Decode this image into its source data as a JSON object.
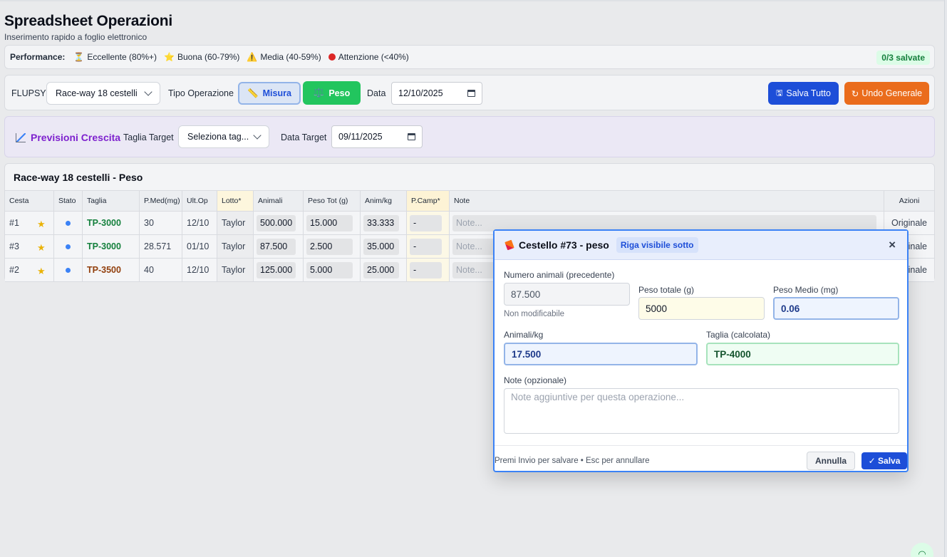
{
  "page": {
    "title": "Spreadsheet Operazioni",
    "subtitle": "Inserimento rapido a foglio elettronico"
  },
  "performance": {
    "label": "Performance:",
    "items": [
      {
        "icon": "hourglass-icon",
        "glyph": "⏳",
        "text": "Eccellente (80%+)"
      },
      {
        "icon": "star-icon",
        "glyph": "⭐",
        "text": "Buona (60-79%)"
      },
      {
        "icon": "warning-icon",
        "glyph": "⚠️",
        "text": "Media (40-59%)"
      },
      {
        "icon": "red-dot-icon",
        "glyph": "",
        "text": "Attenzione (<40%)"
      }
    ],
    "saved_badge": "0/3 salvate"
  },
  "toolbar": {
    "flupsy_label": "FLUPSY",
    "flupsy_value": "Race-way 18 cestelli",
    "tipo_label": "Tipo Operazione",
    "misura_label": "Misura",
    "peso_label": "Peso",
    "data_label": "Data",
    "data_value": "12/10/2025",
    "save_all_label": "Salva Tutto",
    "undo_label": "Undo Generale"
  },
  "forecast": {
    "title": "Previsioni Crescita",
    "target_size_label": "Taglia Target",
    "target_size_value": "Seleziona tag...",
    "target_date_label": "Data Target",
    "target_date_value": "09/11/2025"
  },
  "table": {
    "title": "Race-way 18 cestelli - Peso",
    "columns": [
      "Cesta",
      "Stato",
      "Taglia",
      "P.Med(mg)",
      "Ult.Op",
      "Lotto*",
      "Animali",
      "Peso Tot (g)",
      "Anim/kg",
      "P.Camp*",
      "Note",
      "Azioni"
    ],
    "rows": [
      {
        "cesta": "#1",
        "taglia": "TP-3000",
        "pmed": "30",
        "ultop": "12/10",
        "lotto": "Taylor",
        "animali": "500.000",
        "peso": "15.000",
        "animkg": "33.333",
        "pcamp": "-",
        "note": "Note...",
        "azioni": "Originale"
      },
      {
        "cesta": "#3",
        "taglia": "TP-3000",
        "pmed": "28.571",
        "ultop": "01/10",
        "lotto": "Taylor",
        "animali": "87.500",
        "peso": "2.500",
        "animkg": "35.000",
        "pcamp": "-",
        "note": "Note...",
        "azioni": "Originale"
      },
      {
        "cesta": "#2",
        "taglia": "TP-3500",
        "pmed": "40",
        "ultop": "12/10",
        "lotto": "Taylor",
        "animali": "125.000",
        "peso": "5.000",
        "animkg": "25.000",
        "pcamp": "-",
        "note": "Note...",
        "azioni": "Originale"
      }
    ]
  },
  "modal": {
    "title": "Cestello #73 - peso",
    "badge": "Riga visibile sotto",
    "close": "×",
    "prev_animals_label": "Numero animali (precedente)",
    "prev_animals_value": "87.500",
    "prev_animals_hint": "Non modificabile",
    "peso_totale_label": "Peso totale (g)",
    "peso_totale_value": "5000",
    "peso_medio_label": "Peso Medio (mg)",
    "peso_medio_value": "0.06",
    "animkg_label": "Animali/kg",
    "animkg_value": "17.500",
    "taglia_label": "Taglia (calcolata)",
    "taglia_value": "TP-4000",
    "note_label": "Note (opzionale)",
    "note_placeholder": "Note aggiuntive per questa operazione...",
    "hint": "Premi Invio per salvare • Esc per annullare",
    "cancel_label": "Annulla",
    "save_label": "✓ Salva"
  },
  "colors": {
    "primary": "#1d4ed8",
    "success": "#22c55e",
    "warning": "#ea6c1c",
    "purple": "#7e22ce"
  }
}
